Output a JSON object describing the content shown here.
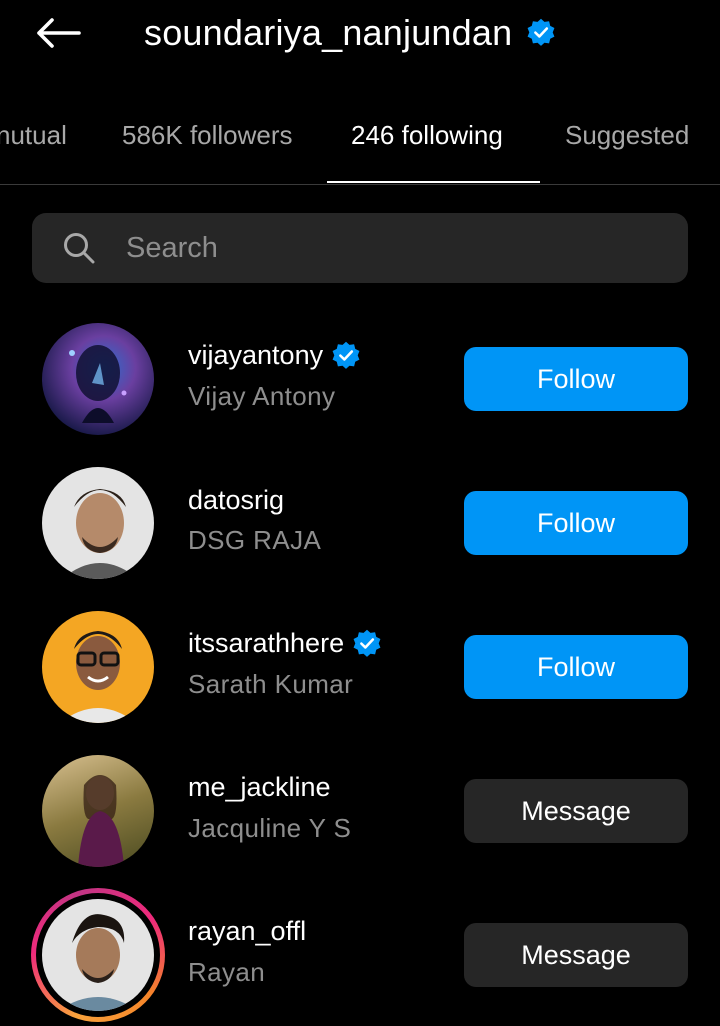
{
  "header": {
    "title": "soundariya_nanjundan",
    "verified": true
  },
  "tabs": [
    {
      "label": "mutual",
      "display": "nutual"
    },
    {
      "label": "586K followers"
    },
    {
      "label": "246 following",
      "active": true
    },
    {
      "label": "Suggested"
    }
  ],
  "search": {
    "placeholder": "Search"
  },
  "colors": {
    "follow_blue": "#0095f6",
    "verified_blue": "#0095f6",
    "message_bg": "#262626",
    "secondary_text": "#8e8e8e"
  },
  "users": [
    {
      "username": "vijayantony",
      "fullname": "Vijay Antony",
      "verified": true,
      "action": "Follow",
      "avatar_colors": [
        "#1a1a4a",
        "#6a3fa0",
        "#2a6fcf"
      ]
    },
    {
      "username": "datosrig",
      "fullname": "DSG RAJA",
      "verified": false,
      "action": "Follow",
      "avatar_colors": [
        "#e8e8e8",
        "#5a4030",
        "#2a2a2a"
      ]
    },
    {
      "username": "itssarathhere",
      "fullname": "Sarath Kumar",
      "verified": true,
      "action": "Follow",
      "avatar_colors": [
        "#f4a623",
        "#6b4a32",
        "#1e1e1e"
      ]
    },
    {
      "username": "me_jackline",
      "fullname": "Jacquline Y S",
      "verified": false,
      "action": "Message",
      "avatar_colors": [
        "#8a7a40",
        "#5a1a4a",
        "#d8c090"
      ]
    },
    {
      "username": "rayan_offl",
      "fullname": "Rayan",
      "verified": false,
      "action": "Message",
      "story_ring": true,
      "avatar_colors": [
        "#e0e0e0",
        "#3a2a20",
        "#6a8aa0"
      ]
    }
  ]
}
